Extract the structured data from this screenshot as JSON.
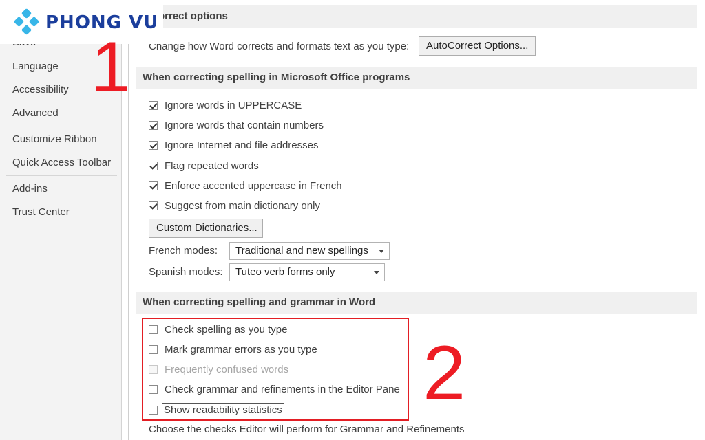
{
  "logo": {
    "text": "PHONG VU"
  },
  "annotations": {
    "first": "1",
    "second": "2"
  },
  "sidebar": {
    "items": [
      {
        "label": "Save"
      },
      {
        "label": "Language"
      },
      {
        "label": "Accessibility"
      },
      {
        "label": "Advanced"
      },
      {
        "label": "Customize Ribbon"
      },
      {
        "label": "Quick Access Toolbar"
      },
      {
        "label": "Add-ins"
      },
      {
        "label": "Trust Center"
      }
    ]
  },
  "autocorrect": {
    "header": "AutoCorrect options",
    "description": "Change how Word corrects and formats text as you type:",
    "button_label": "AutoCorrect Options..."
  },
  "office_spelling": {
    "header": "When correcting spelling in Microsoft Office programs",
    "options": [
      {
        "label": "Ignore words in UPPERCASE",
        "checked": true
      },
      {
        "label": "Ignore words that contain numbers",
        "checked": true
      },
      {
        "label": "Ignore Internet and file addresses",
        "checked": true
      },
      {
        "label": "Flag repeated words",
        "checked": true
      },
      {
        "label": "Enforce accented uppercase in French",
        "checked": true
      },
      {
        "label": "Suggest from main dictionary only",
        "checked": true
      }
    ],
    "custom_dictionaries_label": "Custom Dictionaries...",
    "french_modes_label": "French modes:",
    "french_modes_value": "Traditional and new spellings",
    "spanish_modes_label": "Spanish modes:",
    "spanish_modes_value": "Tuteo verb forms only"
  },
  "word_grammar": {
    "header": "When correcting spelling and grammar in Word",
    "options": [
      {
        "label": "Check spelling as you type",
        "checked": false
      },
      {
        "label": "Mark grammar errors as you type",
        "checked": false
      },
      {
        "label": "Frequently confused words",
        "checked": false,
        "disabled": true
      },
      {
        "label": "Check grammar and refinements in the Editor Pane",
        "checked": false
      },
      {
        "label": "Show readability statistics",
        "checked": false
      }
    ],
    "footer_text": "Choose the checks Editor will perform for Grammar and Refinements"
  },
  "colors": {
    "accent_red": "#ed1c24",
    "logo_blue": "#1b3e9c",
    "logo_cyan": "#38b6e8"
  }
}
